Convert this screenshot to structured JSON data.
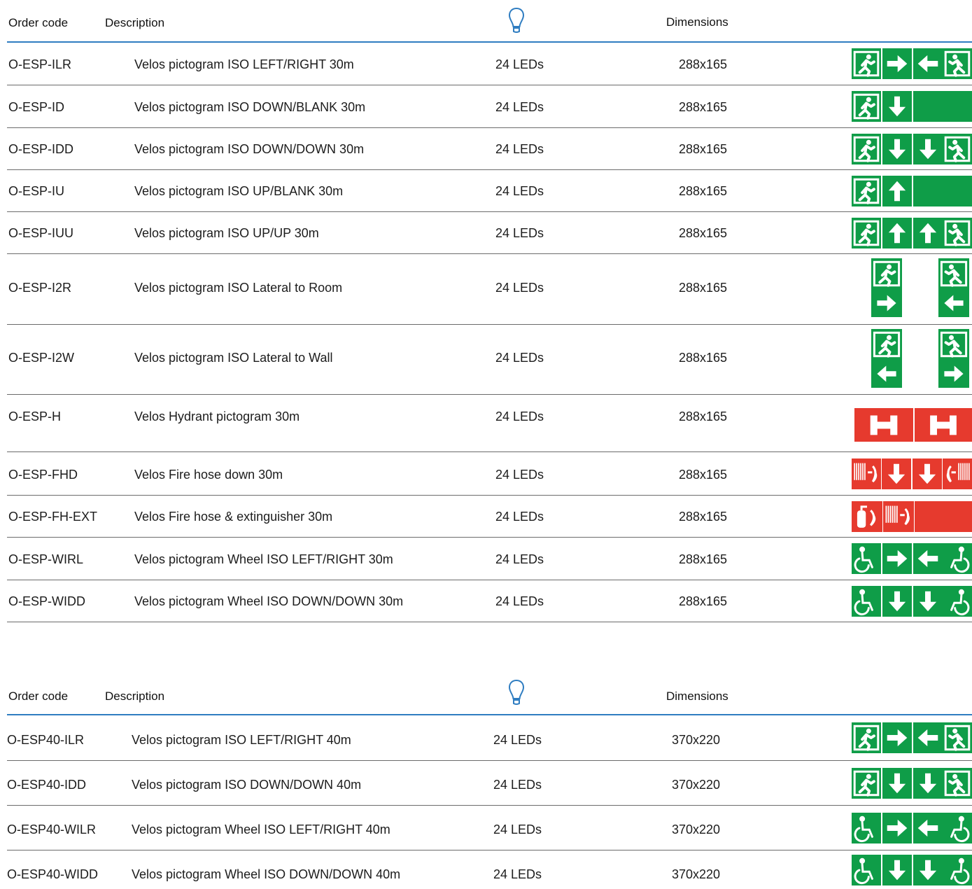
{
  "colors": {
    "green": "#0f9d48",
    "red": "#e63a2e",
    "rule": "#2f7dc1",
    "sep": "#6b6b6b"
  },
  "table1": {
    "headers": {
      "order_code": "Order code",
      "description": "Description",
      "lamp_icon": "bulb-icon",
      "dimensions": "Dimensions"
    },
    "rows": [
      {
        "code": "O-ESP-ILR",
        "desc": "Velos pictogram ISO LEFT/RIGHT 30m",
        "leds": "24 LEDs",
        "dim": "288x165",
        "sign": [
          "runner-left",
          "arrow-right",
          "arrow-left",
          "runner-right"
        ]
      },
      {
        "code": "O-ESP-ID",
        "desc": "Velos pictogram ISO DOWN/BLANK 30m",
        "leds": "24 LEDs",
        "dim": "288x165",
        "sign": [
          "runner-left",
          "arrow-down",
          "blank-wide"
        ]
      },
      {
        "code": "O-ESP-IDD",
        "desc": "Velos pictogram ISO DOWN/DOWN 30m",
        "leds": "24 LEDs",
        "dim": "288x165",
        "sign": [
          "runner-left",
          "arrow-down",
          "arrow-down",
          "runner-right"
        ]
      },
      {
        "code": "O-ESP-IU",
        "desc": "Velos pictogram ISO UP/BLANK 30m",
        "leds": "24 LEDs",
        "dim": "288x165",
        "sign": [
          "runner-left",
          "arrow-up",
          "blank-wide"
        ]
      },
      {
        "code": "O-ESP-IUU",
        "desc": "Velos pictogram ISO UP/UP 30m",
        "leds": "24 LEDs",
        "dim": "288x165",
        "sign": [
          "runner-left",
          "arrow-up",
          "arrow-up",
          "runner-right"
        ]
      },
      {
        "code": "O-ESP-I2R",
        "desc": "Velos pictogram ISO Lateral to Room",
        "leds": "24 LEDs",
        "dim": "288x165",
        "sign": [
          "lateral-room"
        ]
      },
      {
        "code": "O-ESP-I2W",
        "desc": "Velos pictogram ISO Lateral to Wall",
        "leds": "24 LEDs",
        "dim": "288x165",
        "sign": [
          "lateral-wall"
        ]
      },
      {
        "code": "O-ESP-H",
        "desc": "Velos Hydrant pictogram 30m",
        "leds": "24 LEDs",
        "dim": "288x165",
        "sign": [
          "hydrant"
        ]
      },
      {
        "code": "O-ESP-FHD",
        "desc": "Velos Fire hose down 30m",
        "leds": "24 LEDs",
        "dim": "288x165",
        "sign": [
          "firehose-down"
        ]
      },
      {
        "code": "O-ESP-FH-EXT",
        "desc": "Velos Fire hose & extinguisher 30m",
        "leds": "24 LEDs",
        "dim": "288x165",
        "sign": [
          "firehose-ext"
        ]
      },
      {
        "code": "O-ESP-WIRL",
        "desc": "Velos pictogram Wheel ISO LEFT/RIGHT 30m",
        "leds": "24 LEDs",
        "dim": "288x165",
        "sign": [
          "wheel-left",
          "arrow-right",
          "arrow-left",
          "wheel-right"
        ]
      },
      {
        "code": "O-ESP-WIDD",
        "desc": "Velos pictogram Wheel ISO DOWN/DOWN 30m",
        "leds": "24 LEDs",
        "dim": "288x165",
        "sign": [
          "wheel-left",
          "arrow-down",
          "arrow-down",
          "wheel-right"
        ]
      }
    ]
  },
  "table2": {
    "headers": {
      "order_code": "Order code",
      "description": "Description",
      "lamp_icon": "bulb-icon",
      "dimensions": "Dimensions"
    },
    "rows": [
      {
        "code": "O-ESP40-ILR",
        "desc": "Velos pictogram ISO LEFT/RIGHT 40m",
        "leds": "24 LEDs",
        "dim": "370x220",
        "sign": [
          "runner-left",
          "arrow-right",
          "arrow-left",
          "runner-right"
        ]
      },
      {
        "code": "O-ESP40-IDD",
        "desc": "Velos pictogram ISO DOWN/DOWN 40m",
        "leds": "24 LEDs",
        "dim": "370x220",
        "sign": [
          "runner-left",
          "arrow-down",
          "arrow-down",
          "runner-right"
        ]
      },
      {
        "code": "O-ESP40-WILR",
        "desc": "Velos pictogram Wheel ISO LEFT/RIGHT 40m",
        "leds": "24 LEDs",
        "dim": "370x220",
        "sign": [
          "wheel-left",
          "arrow-right",
          "arrow-left",
          "wheel-right"
        ]
      },
      {
        "code": "O-ESP40-WIDD",
        "desc": "Velos pictogram Wheel ISO DOWN/DOWN 40m",
        "leds": "24 LEDs",
        "dim": "370x220",
        "sign": [
          "wheel-left",
          "arrow-down",
          "arrow-down",
          "wheel-right"
        ]
      }
    ]
  }
}
